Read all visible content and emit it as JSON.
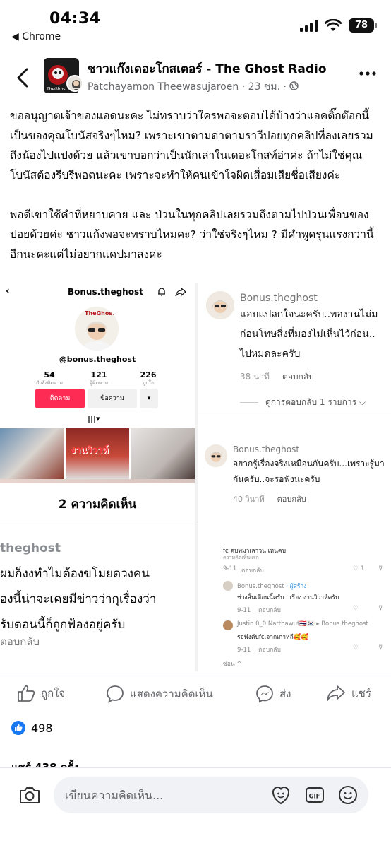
{
  "status_bar": {
    "time": "04:34",
    "back_label": "◀ Chrome",
    "battery": "78"
  },
  "post": {
    "page_name": "ชาวแก๊งเดอะโกสเตอร์ - The Ghost Radio",
    "author": "Patchayamon Theewasujaroen",
    "time": "23 ชม.",
    "page_avatar_text": "TheGhost",
    "paragraph1": "ขออนุญาตเจ้าของแอดนะคะ ไม่ทราบว่าใครพอจะตอบได้บ้างว่าแอคติ๊กต๊อกนี้เป็นของคุณโบนัสจริงๆไหม? เพราะเขาตามด่าตามราวีปอยทุกคลิปที่ลงเลยรวมถึงน้องไปแปงด้วย แล้วเขาบอกว่าเป็นนักเล่าในเดอะโกสท์อ่าค่ะ ถ้าไม่ใช่คุณโบนัสต้องรีบรีพอตนะคะ เพราะจะทำให้คนเข้าใจผิดเสื่อมเสียชื่อเสียงค่ะ",
    "paragraph2": "พอดีเขาใช้คำที่หยาบคาย และ ป่วนในทุกคลิปเลยรวมถึงตามไปป่วนเพื่อนของปอยด้วยค่ะ ชาวแก้งพอจะทราบไหมคะ? ว่าใช่จริงๆไหม ? มีคำพูดรุนแรงกว่านี้อีกนะคะแต่ไม่อยากแคปมาลงค่ะ"
  },
  "shot1": {
    "username": "Bonus.theghost",
    "handle": "@bonus.theghost",
    "avatar_text": "TheGhost",
    "stats": [
      {
        "num": "54",
        "label": "กำลังติดตาม"
      },
      {
        "num": "121",
        "label": "ผู้ติดตาม"
      },
      {
        "num": "226",
        "label": "ถูกใจ"
      }
    ],
    "follow_label": "ติดตาม",
    "message_label": "ข้อความ",
    "more_label": "▾",
    "grid_icon": "|||▾",
    "thumb_text": "งานวิวาห์",
    "comment_count": "2 ความคิดเห็น",
    "commenter": "theghost",
    "lines": [
      "ผมก็งงทำไมต้องขโมยดวงคน",
      "องนี้น่าจะเคยมีข่าวว่ากุเรื่องว่า",
      "รับตอนนี้ก็ถูกฟ้องอยู่ครับ"
    ],
    "reply": "ตอบกลับ"
  },
  "shot2": {
    "name": "Bonus.theghost",
    "lines": [
      "แอบแปลกใจนะครับ..พองานไม่ม",
      "ก่อนโทษสิ่งที่มองไม่เห็นไว้ก่อน..",
      "ไปหมดละครับ"
    ],
    "time": "38 นาที",
    "reply": "ตอบกลับ",
    "view_replies": "ดูการตอบกลับ 1 รายการ ⌵"
  },
  "shot3": {
    "name": "Bonus.theghost",
    "lines": [
      "อยากรู้เรื่องจริงเหมือนกันครับ...เพราะรู้มา",
      "กันครับ..จะรอฟังนะครับ"
    ],
    "time": "40 วินาที",
    "reply": "ตอบกลับ"
  },
  "shot4": {
    "top_line": "fc คบพมาเลาวน เหนคบ",
    "top_sub": "ความคิดเห็นแรก",
    "row1_date": "9-11",
    "row1_reply": "ตอบกลับ",
    "row1_likes": "1",
    "reply1_name": "Bonus.theghost",
    "reply1_badge": "· ผู้สร้าง",
    "reply1_text": "ช่างสิ้นเดือนนี้ครับ...เรื่อง งานวิวาห์ครับ",
    "reply1_date": "9-11",
    "reply1_reply": "ตอบกลับ",
    "reply2_name": "Justin 0_0 Natthawut🇹🇭🇰🇷 ▸ Bonus.theghost",
    "reply2_text": "รอฟังค้บfc.จากเกาหลี🥰🥰",
    "reply2_date": "9-11",
    "reply2_reply": "ตอบกลับ",
    "hide": "ซ่อน ^"
  },
  "actions": {
    "like": "ถูกใจ",
    "comment": "แสดงความคิดเห็น",
    "send": "ส่ง",
    "share": "แชร์"
  },
  "reactions_count": "498",
  "shares": "แชร์ 438 ครั้ง",
  "composer": {
    "placeholder": "เขียนความคิดเห็น..."
  },
  "icons": {
    "back": "back-arrow-icon",
    "more": "more-dots-icon",
    "globe": "globe-icon",
    "camera": "camera-icon",
    "avatar_sticker": "avatar-sticker-icon",
    "gif": "gif-icon",
    "emoji": "emoji-icon"
  },
  "colors": {
    "accent": "#1877f2",
    "tiktok_red": "#fe2c55",
    "muted_text": "#65676b"
  }
}
